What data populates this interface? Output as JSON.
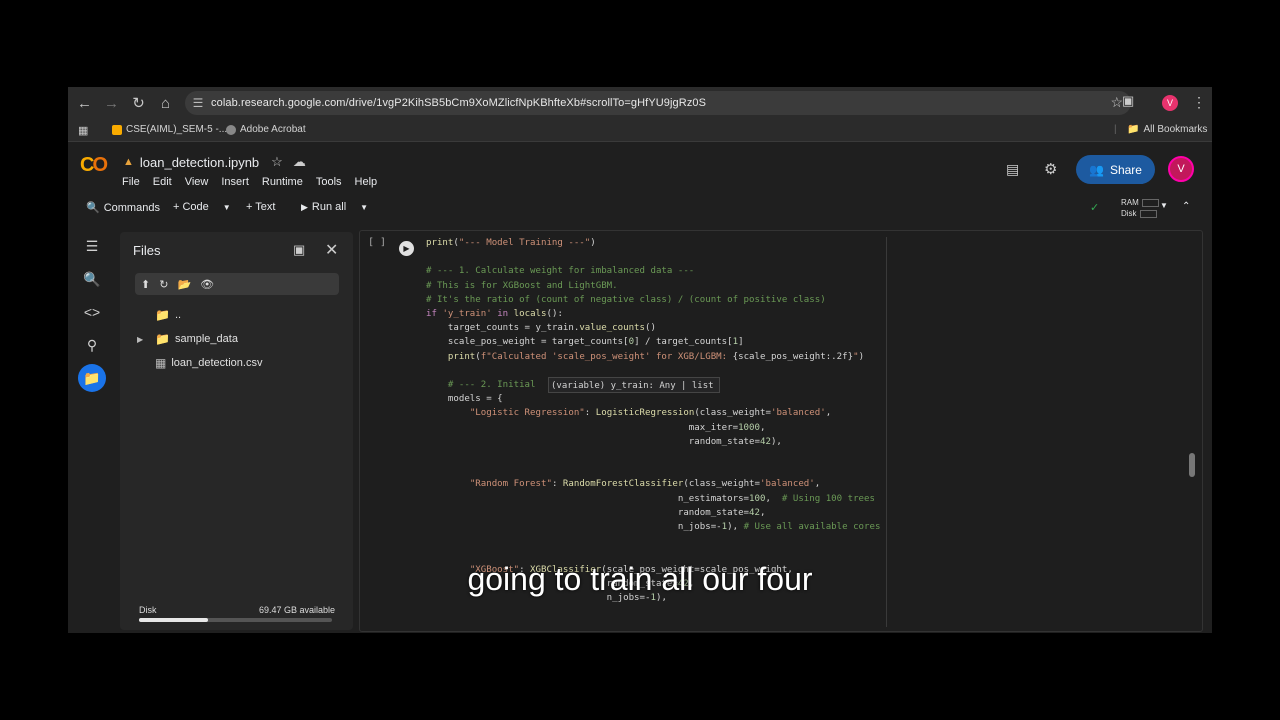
{
  "browser": {
    "url": "colab.research.google.com/drive/1vgP2KihSB5bCm9XoMZlicfNpKBhfteXb#scrollTo=gHfYU9jgRz0S",
    "profile_initial": "V",
    "bookmarks": [
      "CSE(AIML)_SEM-5 -...",
      "Adobe Acrobat"
    ],
    "all_bookmarks": "All Bookmarks"
  },
  "colab": {
    "logo": "CO",
    "notebook_title": "loan_detection.ipynb",
    "menu": [
      "File",
      "Edit",
      "View",
      "Insert",
      "Runtime",
      "Tools",
      "Help"
    ],
    "share_label": "Share",
    "avatar_initial": "V"
  },
  "toolbar": {
    "commands": "Commands",
    "code": "+ Code",
    "text": "+ Text",
    "run_all": "Run all",
    "ram": "RAM",
    "disk": "Disk"
  },
  "files_pane": {
    "title": "Files",
    "items": [
      "..",
      "sample_data",
      "loan_detection.csv"
    ],
    "disk_label": "Disk",
    "disk_available": "69.47 GB available",
    "disk_used_fraction": 0.36
  },
  "cell": {
    "exec_count": "[ ]",
    "tooltip": "(variable) y_train: Any | list"
  },
  "caption": "going to train all our four",
  "colors": {
    "accent": "#1a73e8",
    "share": "#1d5aa0",
    "orange": "#f9ab00"
  },
  "icons": [
    "back-icon",
    "forward-icon",
    "reload-icon",
    "home-icon",
    "star-icon",
    "extension-icon",
    "menu-icon"
  ]
}
